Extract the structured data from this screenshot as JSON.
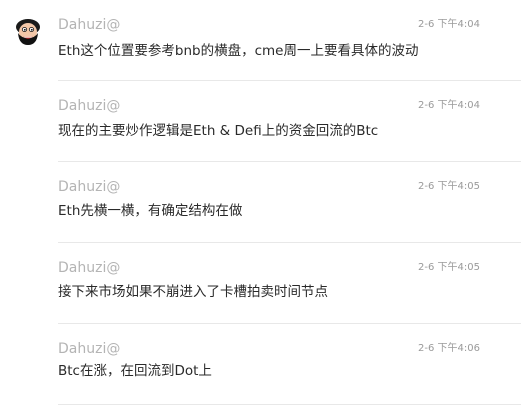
{
  "messages": [
    {
      "author": "Dahuzi@",
      "time": "2-6 下午4:04",
      "text": "Eth这个位置要参考bnb的横盘，cme周一上要看具体的波动",
      "avatar_icon": "bearded-man-cartoon-avatar"
    },
    {
      "author": "Dahuzi@",
      "time": "2-6 下午4:04",
      "text": "现在的主要炒作逻辑是Eth & Defi上的资金回流的Btc"
    },
    {
      "author": "Dahuzi@",
      "time": "2-6 下午4:05",
      "text": "Eth先横一横，有确定结构在做"
    },
    {
      "author": "Dahuzi@",
      "time": "2-6 下午4:05",
      "text": "接下来市场如果不崩进入了卡槽拍卖时间节点"
    },
    {
      "author": "Dahuzi@",
      "time": "2-6 下午4:06",
      "text": "Btc在涨，在回流到Dot上"
    }
  ]
}
